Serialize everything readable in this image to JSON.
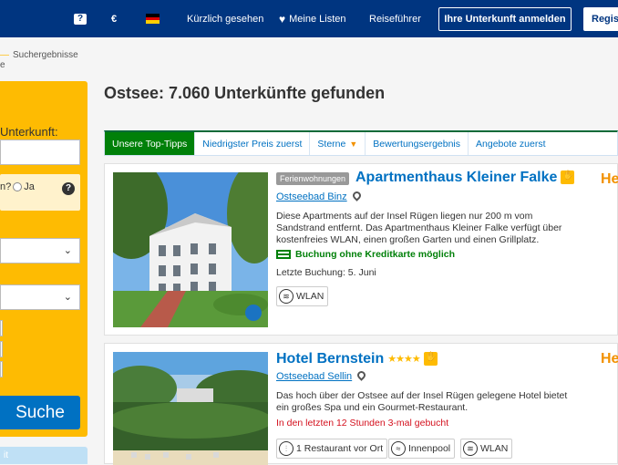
{
  "topbar": {
    "help_icon": "question-icon",
    "currency": "€",
    "flag": "german-flag-icon",
    "recently_viewed": "Kürzlich gesehen",
    "my_lists": "Meine Listen",
    "guide": "Reiseführer",
    "register_property": "Ihre Unterkunft anmelden",
    "register": "Regist"
  },
  "breadcrumb": {
    "item": "Suchergebnisse",
    "item2": "e"
  },
  "sidebar": {
    "label": "Unterkunft:",
    "checkbox_text": "n?",
    "radio_label": "Ja",
    "search_button": "Suche",
    "bottom_label": "it"
  },
  "heading": "Ostsee: 7.060 Unterkünfte gefunden",
  "tabs": [
    {
      "label": "Unsere Top-Tipps"
    },
    {
      "label": "Niedrigster Preis zuerst"
    },
    {
      "label": "Sterne"
    },
    {
      "label": "Bewertungsergebnis"
    },
    {
      "label": "Angebote zuerst"
    }
  ],
  "results": [
    {
      "type_badge": "Ferienwohnungen",
      "title": "Apartmenthaus Kleiner Falke",
      "town": "Ostseebad Binz",
      "description_line1": "Diese Apartments auf der Insel Rügen liegen nur 200 m vom",
      "description_line2": "Sandstrand entfernt. Das Apartmenthaus Kleiner Falke verfügt über",
      "description_line3": "kostenfreies WLAN, einen großen Garten und einen Grillplatz.",
      "no_card": "Buchung ohne Kreditkarte möglich",
      "last_booking": "Letzte Buchung: 5. Juni",
      "facilities": [
        "WLAN"
      ],
      "edge_text": "He"
    },
    {
      "title": "Hotel Bernstein",
      "stars": "★★★★",
      "town": "Ostseebad Sellin",
      "description_line1": "Das hoch über der Ostsee auf der Insel Rügen gelegene Hotel bietet",
      "description_line2": "ein großes Spa und ein Gourmet-Restaurant.",
      "urgency": "In den letzten 12 Stunden 3-mal gebucht",
      "facilities": [
        "1 Restaurant vor Ort",
        "Innenpool",
        "WLAN"
      ],
      "edge_text": "He"
    }
  ],
  "colors": {
    "brand": "#003580",
    "accent": "#febb02",
    "link": "#0071c2",
    "green": "#008009",
    "red": "#d4111e"
  }
}
